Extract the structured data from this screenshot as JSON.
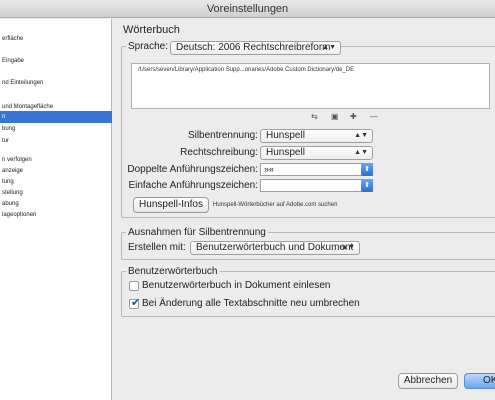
{
  "window": {
    "title": "Voreinstellungen"
  },
  "sidebar": {
    "items": [
      {
        "label": "erfläche"
      },
      {
        "label": "Eingabe"
      },
      {
        "label": "nd Einteilungen"
      },
      {
        "label": "und Montagefläche"
      },
      {
        "label": "n"
      },
      {
        "label": "bung"
      },
      {
        "label": "tur"
      },
      {
        "label": "n verfolgen"
      },
      {
        "label": "anzeige"
      },
      {
        "label": "tung"
      },
      {
        "label": "stellung"
      },
      {
        "label": "abung"
      },
      {
        "label": "lageoptionen"
      }
    ]
  },
  "panel": {
    "title": "Wörterbuch"
  },
  "language_group": {
    "label": "Sprache:",
    "language_value": "Deutsch: 2006 Rechtschreibreform",
    "path": "/Users/seven/Library/Application Supp...onaries/Adobe Custom Dictionary/de_DE",
    "hyphenation_label": "Silbentrennung:",
    "hyphenation_value": "Hunspell",
    "spelling_label": "Rechtschreibung:",
    "spelling_value": "Hunspell",
    "double_quotes_label": "Doppelte Anführungszeichen:",
    "double_quotes_value": "»«",
    "single_quotes_label": "Einfache Anführungszeichen:",
    "single_quotes_value": "",
    "hunspell_button": "Hunspell-Infos",
    "hunspell_note": "Hunspell-Wörterbücher auf Adobe.com suchen"
  },
  "hyphenation_exceptions": {
    "title": "Ausnahmen für Silbentrennung",
    "compose_label": "Erstellen mit:",
    "compose_value": "Benutzerwörterbuch und Dokument"
  },
  "user_dictionary": {
    "title": "Benutzerwörterbuch",
    "merge_label": "Benutzerwörterbuch in Dokument einlesen",
    "merge_checked": false,
    "recompose_label": "Bei Änderung alle Textabschnitte neu umbrechen",
    "recompose_checked": true
  },
  "footer": {
    "cancel": "Abbrechen",
    "ok": "OK"
  }
}
